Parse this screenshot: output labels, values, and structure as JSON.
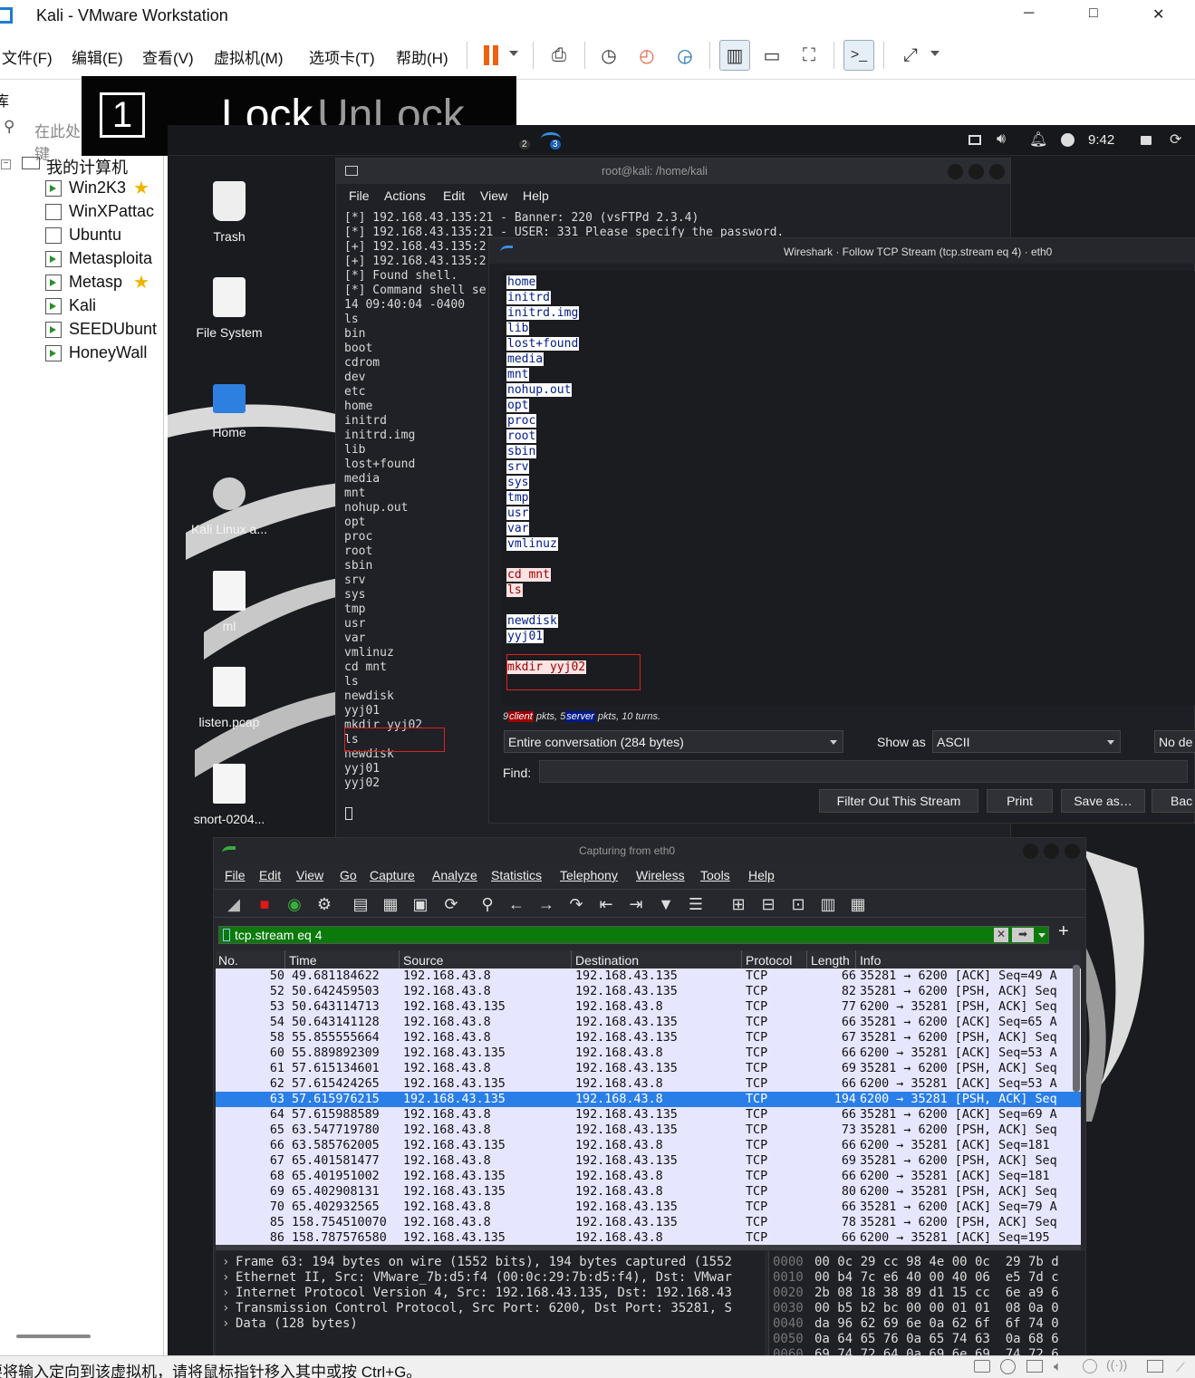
{
  "window": {
    "title": "Kali - VMware Workstation",
    "minimize": "─",
    "maximize": "□",
    "close": "✕"
  },
  "menu": {
    "items": [
      "文件(F)",
      "编辑(E)",
      "查看(V)",
      "虚拟机(M)",
      "选项卡(T)",
      "帮助(H)"
    ]
  },
  "lockbar": {
    "number": "1",
    "lock": "Lock",
    "unlock": "UnLock"
  },
  "library": {
    "title_fragment": "库",
    "search_placeholder": "在此处键",
    "root": "我的计算机",
    "vms": [
      {
        "name": "Win2K3",
        "favorite": true
      },
      {
        "name": "WinXPattac",
        "favorite": false
      },
      {
        "name": "Ubuntu",
        "favorite": false
      },
      {
        "name": "Metasploita",
        "favorite": false
      },
      {
        "name": "Metasp",
        "favorite": true
      },
      {
        "name": "Kali",
        "favorite": false
      },
      {
        "name": "SEEDUbunt",
        "favorite": false
      },
      {
        "name": "HoneyWall",
        "favorite": false
      }
    ]
  },
  "statusbar": {
    "text": "要将输入定向到该虚拟机，请将鼠标指针移入其中或按 Ctrl+G。"
  },
  "kali_panel": {
    "workspace_2": "2",
    "workspace_3": "3",
    "clock": "9:42"
  },
  "desktop": {
    "icons": [
      "Trash",
      "File System",
      "Home",
      "Kali Linux a...",
      "ml",
      "listen.pcap",
      "snort-0204..."
    ]
  },
  "terminal": {
    "title": "root@kali: /home/kali",
    "menu": [
      "File",
      "Actions",
      "Edit",
      "View",
      "Help"
    ],
    "lines": [
      "[*] 192.168.43.135:21 - Banner: 220 (vsFTPd 2.3.4)",
      "[*] 192.168.43.135:21 - USER: 331 Please specify the password.",
      "[+] 192.168.43.135:2",
      "[+] 192.168.43.135:2",
      "[*] Found shell.",
      "[*] Command shell se",
      "14 09:40:04 -0400",
      "",
      "ls",
      "bin",
      "boot",
      "cdrom",
      "dev",
      "etc",
      "home",
      "initrd",
      "initrd.img",
      "lib",
      "lost+found",
      "media",
      "mnt",
      "nohup.out",
      "opt",
      "proc",
      "root",
      "sbin",
      "srv",
      "sys",
      "tmp",
      "usr",
      "var",
      "vmlinuz",
      "cd mnt",
      "ls",
      "newdisk",
      "yyj01",
      "mkdir yyj02",
      "ls",
      "newdisk",
      "yyj01",
      "yyj02"
    ]
  },
  "follow_stream": {
    "title": "Wireshark · Follow TCP Stream (tcp.stream eq 4) · eth0",
    "blocks": [
      {
        "type": "server",
        "lines": [
          "home",
          "initrd",
          "initrd.img",
          "lib",
          "lost+found",
          "media",
          "mnt",
          "nohup.out",
          "opt",
          "proc",
          "root",
          "sbin",
          "srv",
          "sys",
          "tmp",
          "usr",
          "var",
          "vmlinuz"
        ]
      },
      {
        "type": "client",
        "lines": [
          "cd mnt",
          "ls"
        ]
      },
      {
        "type": "server",
        "lines": [
          "newdisk",
          "yyj01"
        ]
      },
      {
        "type": "client",
        "lines": [
          "mkdir yyj02"
        ]
      }
    ],
    "stats_prefix": "9",
    "stats_client": "client",
    "stats_mid": "pkts, 5",
    "stats_server": "server",
    "stats_suffix": "pkts, 10 turns.",
    "conversation": "Entire conversation (284 bytes)",
    "show_as_label": "Show as",
    "show_as_value": "ASCII",
    "no_delta": "No de",
    "find_label": "Find:",
    "buttons": [
      "Filter Out This Stream",
      "Print",
      "Save as…",
      "Bac"
    ]
  },
  "wireshark": {
    "title": "Capturing from eth0",
    "menu": [
      "File",
      "Edit",
      "View",
      "Go",
      "Capture",
      "Analyze",
      "Statistics",
      "Telephony",
      "Wireless",
      "Tools",
      "Help"
    ],
    "filter": "tcp.stream eq 4",
    "columns": [
      "No.",
      "Time",
      "Source",
      "Destination",
      "Protocol",
      "Length",
      "Info"
    ],
    "packets": [
      {
        "no": "50",
        "time": "49.681184622",
        "src": "192.168.43.8",
        "dst": "192.168.43.135",
        "proto": "TCP",
        "len": "66",
        "info": "35281 → 6200 [ACK] Seq=49 A"
      },
      {
        "no": "52",
        "time": "50.642459503",
        "src": "192.168.43.8",
        "dst": "192.168.43.135",
        "proto": "TCP",
        "len": "82",
        "info": "35281 → 6200 [PSH, ACK] Seq"
      },
      {
        "no": "53",
        "time": "50.643114713",
        "src": "192.168.43.135",
        "dst": "192.168.43.8",
        "proto": "TCP",
        "len": "77",
        "info": "6200 → 35281 [PSH, ACK] Seq"
      },
      {
        "no": "54",
        "time": "50.643141128",
        "src": "192.168.43.8",
        "dst": "192.168.43.135",
        "proto": "TCP",
        "len": "66",
        "info": "35281 → 6200 [ACK] Seq=65 A"
      },
      {
        "no": "58",
        "time": "55.855555664",
        "src": "192.168.43.8",
        "dst": "192.168.43.135",
        "proto": "TCP",
        "len": "67",
        "info": "35281 → 6200 [PSH, ACK] Seq"
      },
      {
        "no": "60",
        "time": "55.889892309",
        "src": "192.168.43.135",
        "dst": "192.168.43.8",
        "proto": "TCP",
        "len": "66",
        "info": "6200 → 35281 [ACK] Seq=53 A"
      },
      {
        "no": "61",
        "time": "57.615134601",
        "src": "192.168.43.8",
        "dst": "192.168.43.135",
        "proto": "TCP",
        "len": "69",
        "info": "35281 → 6200 [PSH, ACK] Seq"
      },
      {
        "no": "62",
        "time": "57.615424265",
        "src": "192.168.43.135",
        "dst": "192.168.43.8",
        "proto": "TCP",
        "len": "66",
        "info": "6200 → 35281 [ACK] Seq=53 A"
      },
      {
        "no": "63",
        "time": "57.615976215",
        "src": "192.168.43.135",
        "dst": "192.168.43.8",
        "proto": "TCP",
        "len": "194",
        "info": "6200 → 35281 [PSH, ACK] Seq",
        "selected": true
      },
      {
        "no": "64",
        "time": "57.615988589",
        "src": "192.168.43.8",
        "dst": "192.168.43.135",
        "proto": "TCP",
        "len": "66",
        "info": "35281 → 6200 [ACK] Seq=69 A"
      },
      {
        "no": "65",
        "time": "63.547719780",
        "src": "192.168.43.8",
        "dst": "192.168.43.135",
        "proto": "TCP",
        "len": "73",
        "info": "35281 → 6200 [PSH, ACK] Seq"
      },
      {
        "no": "66",
        "time": "63.585762005",
        "src": "192.168.43.135",
        "dst": "192.168.43.8",
        "proto": "TCP",
        "len": "66",
        "info": "6200 → 35281 [ACK] Seq=181"
      },
      {
        "no": "67",
        "time": "65.401581477",
        "src": "192.168.43.8",
        "dst": "192.168.43.135",
        "proto": "TCP",
        "len": "69",
        "info": "35281 → 6200 [PSH, ACK] Seq"
      },
      {
        "no": "68",
        "time": "65.401951002",
        "src": "192.168.43.135",
        "dst": "192.168.43.8",
        "proto": "TCP",
        "len": "66",
        "info": "6200 → 35281 [ACK] Seq=181"
      },
      {
        "no": "69",
        "time": "65.402908131",
        "src": "192.168.43.135",
        "dst": "192.168.43.8",
        "proto": "TCP",
        "len": "80",
        "info": "6200 → 35281 [PSH, ACK] Seq"
      },
      {
        "no": "70",
        "time": "65.402932565",
        "src": "192.168.43.8",
        "dst": "192.168.43.135",
        "proto": "TCP",
        "len": "66",
        "info": "35281 → 6200 [ACK] Seq=79 A"
      },
      {
        "no": "85",
        "time": "158.754510070",
        "src": "192.168.43.8",
        "dst": "192.168.43.135",
        "proto": "TCP",
        "len": "78",
        "info": "35281 → 6200 [PSH, ACK] Seq"
      },
      {
        "no": "86",
        "time": "158.787576580",
        "src": "192.168.43.135",
        "dst": "192.168.43.8",
        "proto": "TCP",
        "len": "66",
        "info": "6200 → 35281 [ACK] Seq=195"
      }
    ],
    "details": [
      "Frame 63: 194 bytes on wire (1552 bits), 194 bytes captured (1552",
      "Ethernet II, Src: VMware_7b:d5:f4 (00:0c:29:7b:d5:f4), Dst: VMwar",
      "Internet Protocol Version 4, Src: 192.168.43.135, Dst: 192.168.43",
      "Transmission Control Protocol, Src Port: 6200, Dst Port: 35281, S",
      "Data (128 bytes)"
    ],
    "hex": [
      {
        "off": "0000",
        "bytes": "00 0c 29 cc 98 4e 00 0c  29 7b d"
      },
      {
        "off": "0010",
        "bytes": "00 b4 7c e6 40 00 40 06  e5 7d c"
      },
      {
        "off": "0020",
        "bytes": "2b 08 18 38 89 d1 15 cc  6e a9 6"
      },
      {
        "off": "0030",
        "bytes": "00 b5 b2 bc 00 00 01 01  08 0a 0"
      },
      {
        "off": "0040",
        "bytes": "da 96 62 69 6e 0a 62 6f  6f 74 0"
      },
      {
        "off": "0050",
        "bytes": "0a 64 65 76 0a 65 74 63  0a 68 6"
      },
      {
        "off": "0060",
        "bytes": "69 74 72 64 0a 69 6e 69  74 72 6"
      }
    ]
  },
  "colors": {
    "kali_bg": "#1a1b1f",
    "client_bg": "#fde4e4",
    "client_fg": "#a00000",
    "server_bg": "#ffffff",
    "server_fg": "#001a8c",
    "selected_row": "#2a7ee8",
    "tcp_row": "#e7e6ff",
    "filter_ok": "#0b7a0b",
    "highlight_box": "#e02020"
  }
}
